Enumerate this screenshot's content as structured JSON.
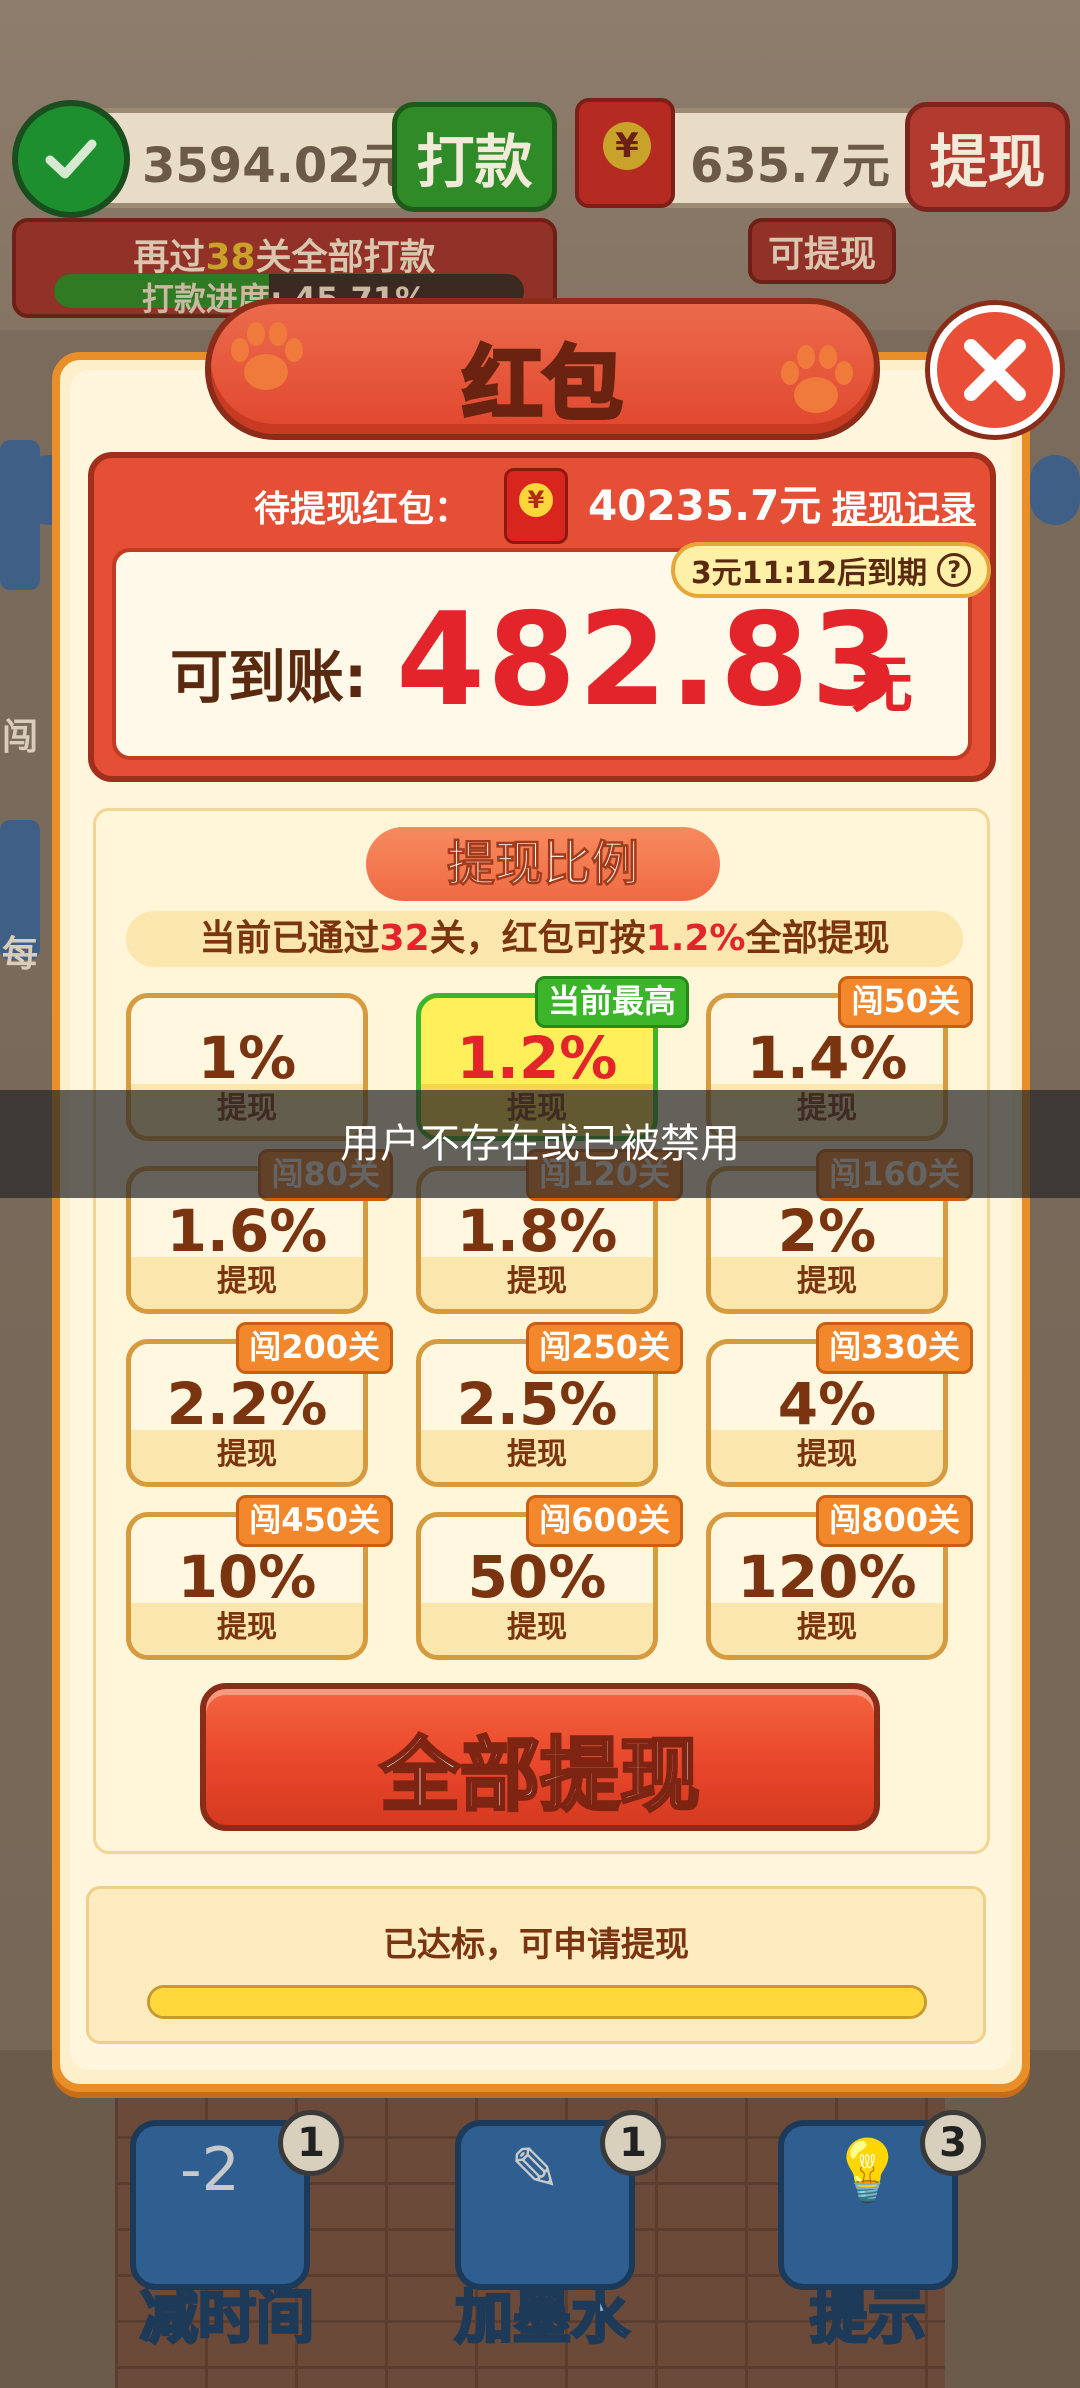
{
  "top_bar": {
    "wechat_amount": "3594.02元",
    "pay_button": "打款",
    "redbag_amount": "635.7元",
    "withdraw_button": "提现",
    "withdrawable_badge": "可提现",
    "levels_prefix": "再过",
    "levels_count": "38",
    "levels_suffix": "关全部打款",
    "progress_text": "打款进度: 45.71%",
    "progress_value": 0.4571
  },
  "side_texts": [
    "闯",
    "每"
  ],
  "modal": {
    "title": "红包",
    "pending_label": "待提现红包：",
    "pending_amount": "40235.7元",
    "record_link": "提现记录",
    "expire_text": "3元11:12后到期",
    "help_glyph": "?",
    "arrive_label": "可到账:",
    "arrive_amount": "482.83",
    "arrive_unit": "元",
    "ratio_title": "提现比例",
    "ratio_desc_prefix": "当前已通过",
    "ratio_desc_levels": "32",
    "ratio_desc_mid": "关，红包可按",
    "ratio_desc_pct": "1.2%",
    "ratio_desc_suffix": "全部提现",
    "cells": [
      {
        "pct": "1%",
        "label": "提现",
        "tag": ""
      },
      {
        "pct": "1.2%",
        "label": "提现",
        "tag": "当前最高"
      },
      {
        "pct": "1.4%",
        "label": "提现",
        "tag": "闯50关"
      },
      {
        "pct": "1.6%",
        "label": "提现",
        "tag": "闯80关"
      },
      {
        "pct": "1.8%",
        "label": "提现",
        "tag": "闯120关"
      },
      {
        "pct": "2%",
        "label": "提现",
        "tag": "闯160关"
      },
      {
        "pct": "2.2%",
        "label": "提现",
        "tag": "闯200关"
      },
      {
        "pct": "2.5%",
        "label": "提现",
        "tag": "闯250关"
      },
      {
        "pct": "4%",
        "label": "提现",
        "tag": "闯330关"
      },
      {
        "pct": "10%",
        "label": "提现",
        "tag": "闯450关"
      },
      {
        "pct": "50%",
        "label": "提现",
        "tag": "闯600关"
      },
      {
        "pct": "120%",
        "label": "提现",
        "tag": "闯800关"
      }
    ],
    "withdraw_all": "全部提现",
    "reach_text": "已达标，可申请提现",
    "reach_progress": 1.0
  },
  "toast": "用户不存在或已被禁用",
  "tools": [
    {
      "label": "减时间",
      "count": "1",
      "icon": "-2"
    },
    {
      "label": "加墨水",
      "count": "1",
      "icon": "✎"
    },
    {
      "label": "提示",
      "count": "3",
      "icon": "💡"
    }
  ],
  "colors": {
    "accent_red": "#e3242b",
    "modal_border": "#e98f2a",
    "active_green": "#3cb52a",
    "tag_orange": "#f2872c"
  }
}
